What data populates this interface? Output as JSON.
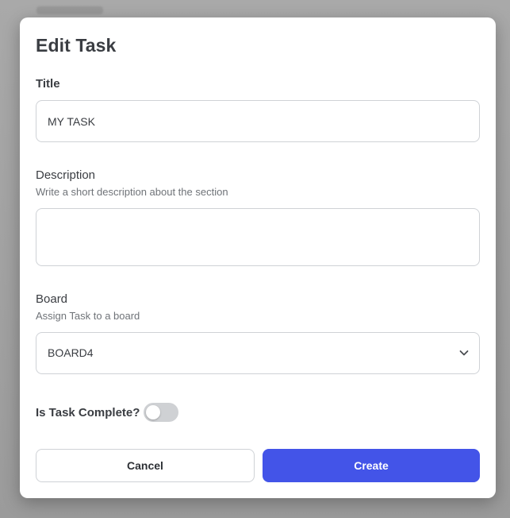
{
  "modal": {
    "title": "Edit Task",
    "title_field": {
      "label": "Title",
      "value": "MY TASK"
    },
    "description_field": {
      "label": "Description",
      "hint": "Write a short description about the section",
      "value": ""
    },
    "board_field": {
      "label": "Board",
      "hint": "Assign Task to a board",
      "selected": "BOARD4",
      "icon": "chevron-down-icon"
    },
    "complete_toggle": {
      "label": "Is Task Complete?",
      "checked": false
    },
    "buttons": {
      "cancel": "Cancel",
      "create": "Create"
    }
  },
  "colors": {
    "primary": "#4354e8",
    "text": "#3a3d42",
    "hint": "#6f7378",
    "border": "#cfd2d6",
    "toggle_off": "#cfd1d4",
    "overlay": "#9e9e9e"
  }
}
